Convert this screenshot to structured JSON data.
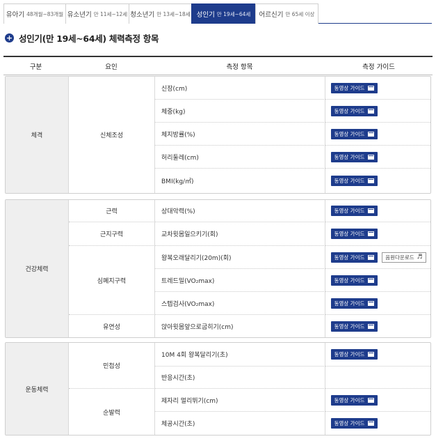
{
  "tabs": [
    {
      "label": "유아기",
      "sub": "48개월~83개월",
      "active": false
    },
    {
      "label": "유소년기",
      "sub": "만 11세~12세",
      "active": false
    },
    {
      "label": "청소년기",
      "sub": "만 13세~18세",
      "active": false
    },
    {
      "label": "성인기",
      "sub": "만 19세~64세",
      "active": true
    },
    {
      "label": "어르신기",
      "sub": "만 65세 이상",
      "active": false
    }
  ],
  "section": {
    "title": "성인기(만 19세~64세) 체력측정 항목"
  },
  "table": {
    "headers": {
      "category": "구분",
      "factor": "요인",
      "item": "측정 항목",
      "guide": "측정 가이드"
    },
    "video_label": "동영상 가이드",
    "download_label": "음원다운로드",
    "groups": [
      {
        "category": "체격",
        "factors": [
          {
            "name": "신체조성",
            "items": [
              {
                "name": "신장(cm)",
                "video": true,
                "download": false
              },
              {
                "name": "체중(kg)",
                "video": true,
                "download": false
              },
              {
                "name": "체지방률(%)",
                "video": true,
                "download": false
              },
              {
                "name": "허리둘레(cm)",
                "video": true,
                "download": false
              },
              {
                "name": "BMI(kg/㎡)",
                "video": true,
                "download": false
              }
            ]
          }
        ]
      },
      {
        "category": "건강체력",
        "factors": [
          {
            "name": "근력",
            "items": [
              {
                "name": "상대악력(%)",
                "video": true,
                "download": false
              }
            ]
          },
          {
            "name": "근지구력",
            "items": [
              {
                "name": "교차윗몸일으키기(회)",
                "video": true,
                "download": false
              }
            ]
          },
          {
            "name": "심폐지구력",
            "items": [
              {
                "name": "왕복오래달리기(20m)(회)",
                "video": true,
                "download": true
              },
              {
                "name": "트레드밀(VO₂max)",
                "video": true,
                "download": false
              },
              {
                "name": "스텝검사(VO₂max)",
                "video": true,
                "download": false
              }
            ]
          },
          {
            "name": "유연성",
            "items": [
              {
                "name": "앉아윗몸앞으로굽히기(cm)",
                "video": true,
                "download": false
              }
            ]
          }
        ]
      },
      {
        "category": "운동체력",
        "factors": [
          {
            "name": "민첩성",
            "items": [
              {
                "name": "10M 4회 왕복달리기(초)",
                "video": true,
                "download": false
              },
              {
                "name": "반응시간(초)",
                "video": false,
                "download": false
              }
            ]
          },
          {
            "name": "순발력",
            "items": [
              {
                "name": "제자리 멀리뛰기(cm)",
                "video": true,
                "download": false
              },
              {
                "name": "체공시간(초)",
                "video": true,
                "download": false
              }
            ]
          }
        ]
      }
    ]
  },
  "colors": {
    "accent": "#1e3c8c",
    "category_bg": "#efefef"
  }
}
